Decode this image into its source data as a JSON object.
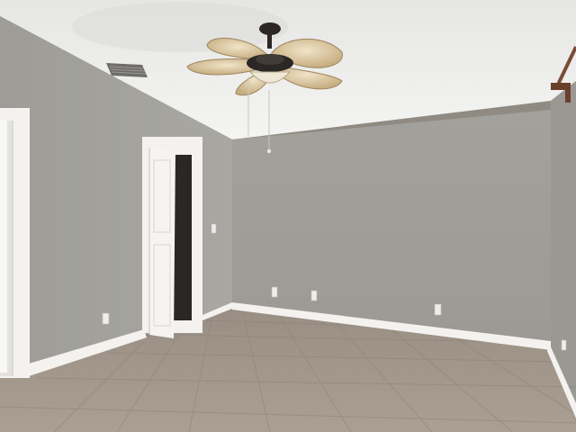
{
  "scene": {
    "subject": "empty-room",
    "colors": {
      "ceiling": "#eeeeec",
      "left_wall": "#a4a39e",
      "back_wall": "#a19f98",
      "right_wall": "#9d9b95",
      "floor": "#a59a8f",
      "trim": "#f3f2ef",
      "fan_blade": "#c9ad7f",
      "fan_motor": "#2b2724"
    },
    "icons": [
      "ceiling-fan-icon",
      "air-vent-icon",
      "electrical-outlet-icon",
      "light-switch-icon",
      "door-icon"
    ]
  }
}
